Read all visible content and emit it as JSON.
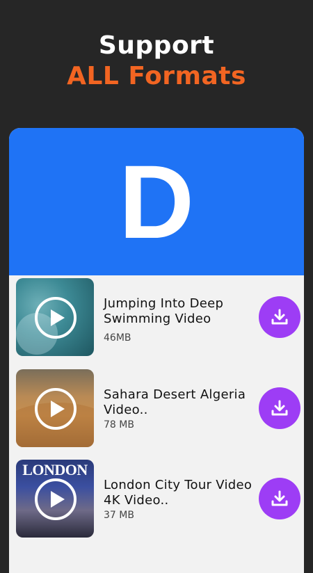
{
  "headline": {
    "line1": "Support",
    "line2": "ALL Formats"
  },
  "banner": {
    "letter": "D",
    "color": "#1f73f5"
  },
  "videos": [
    {
      "title": "Jumping Into Deep Swimming Video",
      "size": "46MB"
    },
    {
      "title": "Sahara Desert Algeria Video..",
      "size": "78 MB"
    },
    {
      "title": "London City Tour Video 4K Video..",
      "size": "37 MB",
      "thumb_text": "LONDON"
    }
  ],
  "colors": {
    "accent": "#f26522",
    "download": "#9d3df5",
    "background": "#262626"
  },
  "icons": {
    "play": "play-icon",
    "download": "download-icon"
  }
}
